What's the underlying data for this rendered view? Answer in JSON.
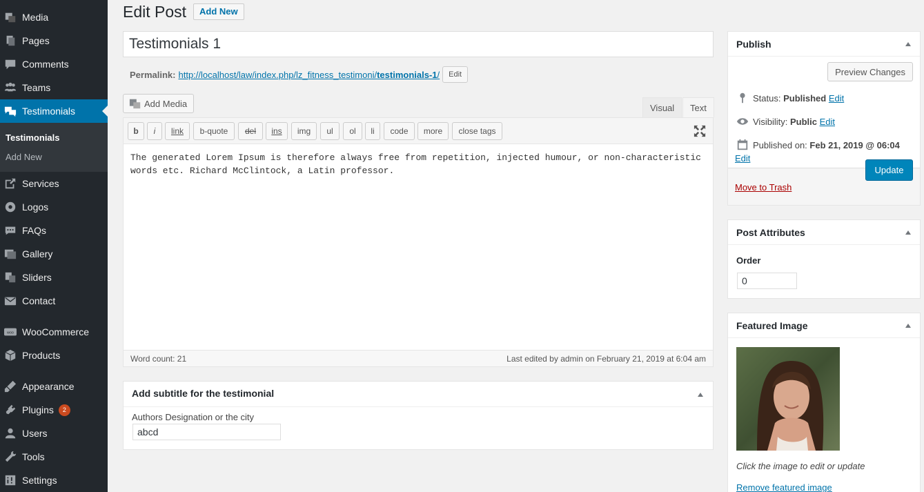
{
  "sidebar": {
    "items": [
      {
        "label": "Media",
        "icon": "media-icon"
      },
      {
        "label": "Pages",
        "icon": "pages-icon"
      },
      {
        "label": "Comments",
        "icon": "comments-icon"
      },
      {
        "label": "Teams",
        "icon": "teams-icon"
      },
      {
        "label": "Testimonials",
        "icon": "testimonials-icon"
      },
      {
        "label": "Services",
        "icon": "services-icon"
      },
      {
        "label": "Logos",
        "icon": "logos-icon"
      },
      {
        "label": "FAQs",
        "icon": "faqs-icon"
      },
      {
        "label": "Gallery",
        "icon": "gallery-icon"
      },
      {
        "label": "Sliders",
        "icon": "sliders-icon"
      },
      {
        "label": "Contact",
        "icon": "contact-icon"
      },
      {
        "label": "WooCommerce",
        "icon": "woocommerce-icon"
      },
      {
        "label": "Products",
        "icon": "products-icon"
      },
      {
        "label": "Appearance",
        "icon": "appearance-icon"
      },
      {
        "label": "Plugins",
        "icon": "plugins-icon",
        "badge": "2"
      },
      {
        "label": "Users",
        "icon": "users-icon"
      },
      {
        "label": "Tools",
        "icon": "tools-icon"
      },
      {
        "label": "Settings",
        "icon": "settings-icon"
      }
    ],
    "submenu": [
      "Testimonials",
      "Add New"
    ]
  },
  "header": {
    "title": "Edit Post",
    "add_new": "Add New"
  },
  "post": {
    "title": "Testimonials 1",
    "permalink_label": "Permalink:",
    "permalink_base": "http://localhost/law/index.php/lz_fitness_testimoni/",
    "permalink_slug": "testimonials-1",
    "permalink_trail": "/",
    "permalink_edit": "Edit"
  },
  "editor": {
    "add_media": "Add Media",
    "tab_visual": "Visual",
    "tab_text": "Text",
    "buttons": [
      "b",
      "i",
      "link",
      "b-quote",
      "del",
      "ins",
      "img",
      "ul",
      "ol",
      "li",
      "code",
      "more",
      "close tags"
    ],
    "content_line1": "The generated Lorem Ipsum is therefore always free from repetition, injected humour, or non-characteristic",
    "content_line2": "words etc. Richard McClintock, a Latin professor.",
    "word_count": "Word count: 21",
    "last_edited": "Last edited by admin on February 21, 2019 at 6:04 am"
  },
  "subtitle_box": {
    "title": "Add subtitle for the testimonial",
    "field_label": "Authors Designation or the city",
    "field_value": "abcd"
  },
  "publish": {
    "title": "Publish",
    "preview": "Preview Changes",
    "status_label": "Status:",
    "status_value": "Published",
    "visibility_label": "Visibility:",
    "visibility_value": "Public",
    "published_label": "Published on:",
    "published_value": "Feb 21, 2019 @ 06:04",
    "edit": "Edit",
    "trash": "Move to Trash",
    "update": "Update"
  },
  "attributes": {
    "title": "Post Attributes",
    "order_label": "Order",
    "order_value": "0"
  },
  "featured": {
    "title": "Featured Image",
    "hint": "Click the image to edit or update",
    "remove": "Remove featured image"
  },
  "colors": {
    "sidebar_bg": "#23282d",
    "accent": "#0073aa",
    "update_btn": "#0085ba",
    "trash": "#a00"
  }
}
